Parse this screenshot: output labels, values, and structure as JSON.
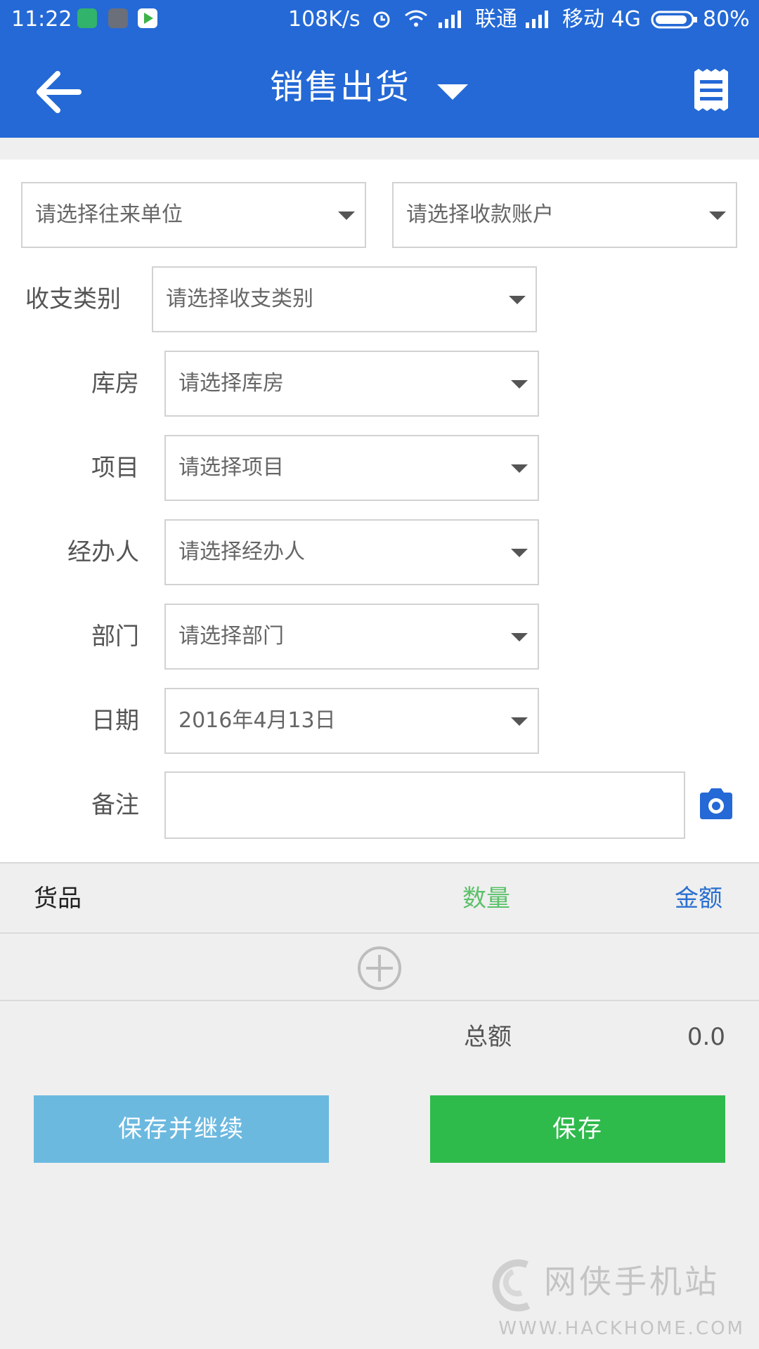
{
  "status_bar": {
    "time": "11:22",
    "network_speed": "108K/s",
    "carrier1": "联通",
    "carrier2": "移动 4G",
    "battery": "80%"
  },
  "app_bar": {
    "title": "销售出货"
  },
  "form": {
    "partner_placeholder": "请选择往来单位",
    "account_placeholder": "请选择收款账户",
    "category_label": "收支类别",
    "category_placeholder": "请选择收支类别",
    "warehouse_label": "库房",
    "warehouse_placeholder": "请选择库房",
    "project_label": "项目",
    "project_placeholder": "请选择项目",
    "handler_label": "经办人",
    "handler_placeholder": "请选择经办人",
    "department_label": "部门",
    "department_placeholder": "请选择部门",
    "date_label": "日期",
    "date_value": "2016年4月13日",
    "remark_label": "备注",
    "remark_value": ""
  },
  "items": {
    "col_goods": "货品",
    "col_quantity": "数量",
    "col_amount": "金额",
    "total_label": "总额",
    "total_value": "0.0"
  },
  "actions": {
    "save_continue": "保存并继续",
    "save": "保存"
  },
  "watermark": {
    "name": "网侠手机站",
    "url": "WWW.HACKHOME.COM"
  },
  "colors": {
    "primary": "#2469d6",
    "quantity": "#5cc16a",
    "amount": "#2a6fd0",
    "save_continue_bg": "#6cb9e0",
    "save_bg": "#2fba4c"
  }
}
